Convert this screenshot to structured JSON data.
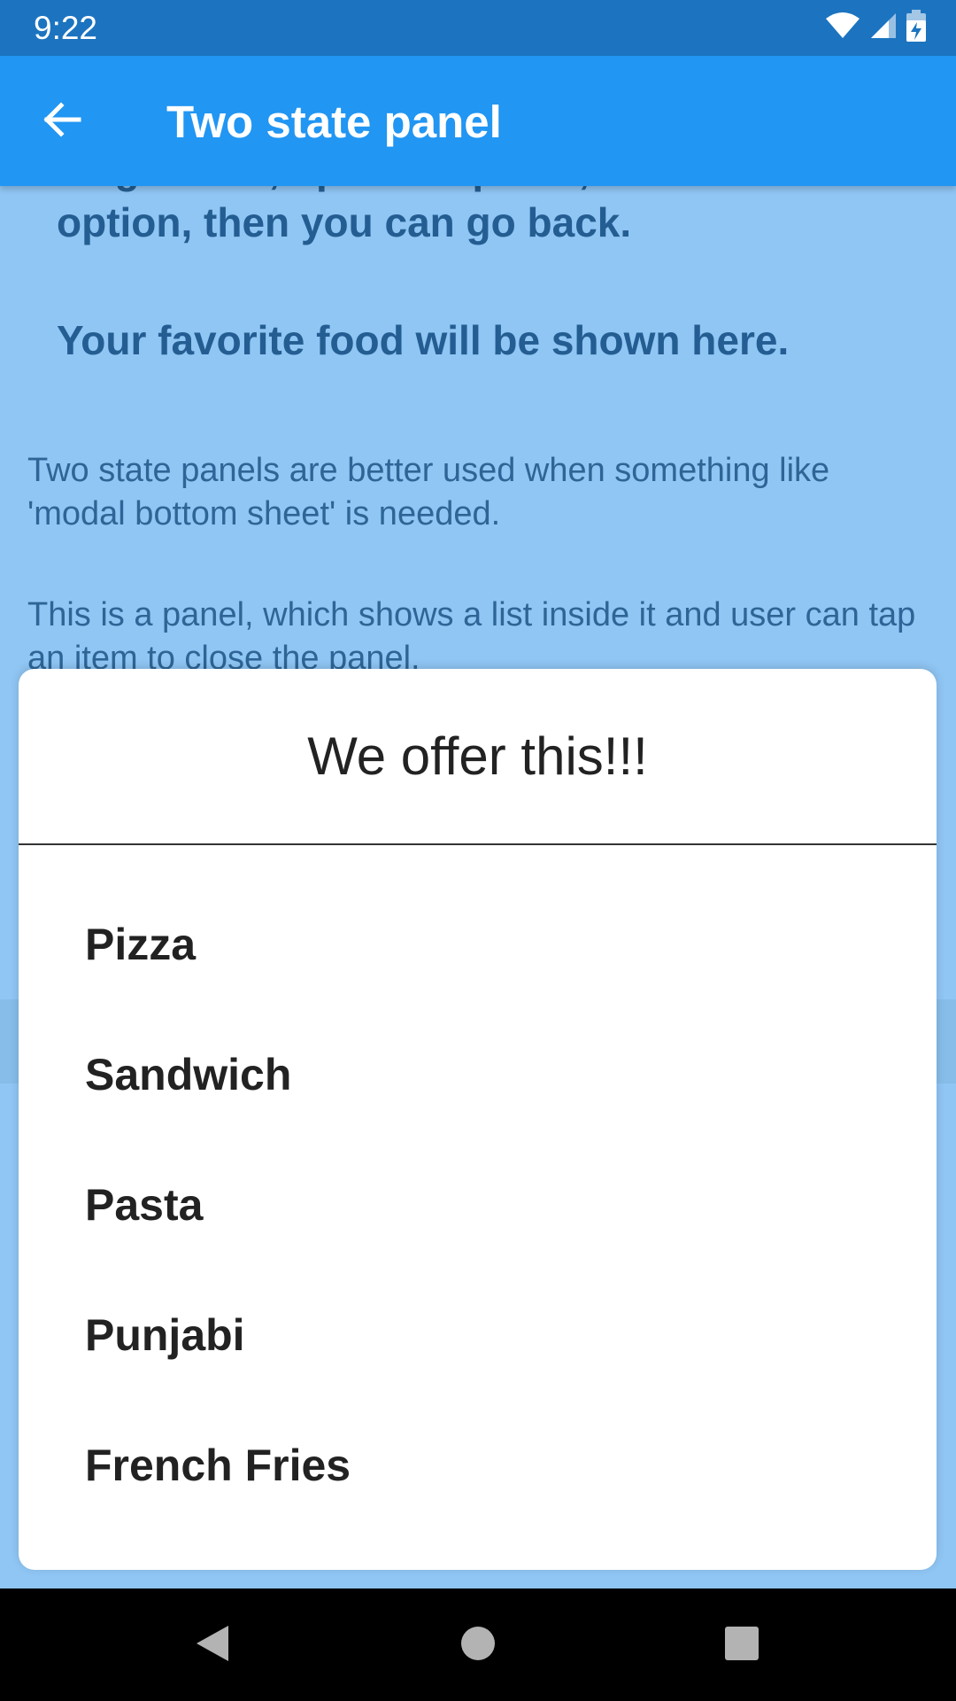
{
  "status_bar": {
    "time": "9:22",
    "icons": [
      "wifi-icon",
      "cell-signal-icon",
      "battery-charging-icon"
    ]
  },
  "app_bar": {
    "title": "Two state panel",
    "back_icon": "arrow-back-icon",
    "background": "#2196f3"
  },
  "content": {
    "line1": "To go back, open the panel, select an option, then you can go back.",
    "line2": "Your favorite food will be shown here.",
    "para1": "Two state panels are better used when something like 'modal bottom sheet' is needed.",
    "para2": "This is a panel, which shows a list inside it and user can tap an item to close the panel."
  },
  "panel": {
    "title": "We offer this!!!",
    "items": [
      {
        "label": "Pizza"
      },
      {
        "label": "Sandwich"
      },
      {
        "label": "Pasta"
      },
      {
        "label": "Punjabi"
      },
      {
        "label": "French Fries"
      }
    ]
  },
  "nav_bar": {
    "icons": [
      "nav-back-icon",
      "nav-home-icon",
      "nav-recents-icon"
    ]
  }
}
